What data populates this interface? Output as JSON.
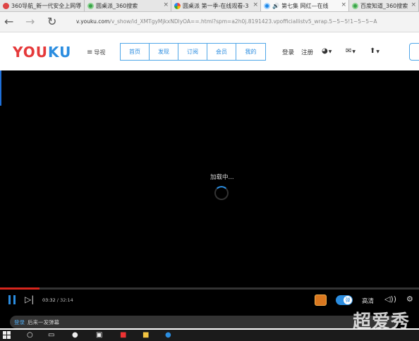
{
  "browser": {
    "tabs": [
      {
        "label": "360导航_新一代安全上网导",
        "favicon": "red-360-icon"
      },
      {
        "label": "圆桌派_360搜索",
        "favicon": "green-360-search-icon"
      },
      {
        "label": "圆桌派 第一季-在线观看-3",
        "favicon": "colorful-site-icon"
      },
      {
        "label": "第七集 网红—在线",
        "favicon": "youku-icon",
        "active": true,
        "audio": "🔊"
      },
      {
        "label": "百度知道_360搜索",
        "favicon": "green-360-search-icon"
      }
    ],
    "back_icon": "←",
    "forward_icon": "→",
    "refresh_icon": "↻",
    "url_host": "v.youku.com",
    "url_path": "/v_show/id_XMTgyMjkxNDlyOA==.html?spm=a2h0j.8191423.vpofficiallistv5_wrap.5~5~5!1~5~5~A"
  },
  "youku": {
    "logo_a": "YOU",
    "logo_b": "KU",
    "menu_label": "导视",
    "nav": [
      "首页",
      "发现",
      "订阅",
      "会员",
      "我的"
    ],
    "login": "登录",
    "register": "注册",
    "icons": [
      "clock-icon",
      "mail-icon",
      "upload-icon"
    ]
  },
  "player": {
    "loading_text": "加载中...",
    "current_time": "03:32",
    "time_sep": " / ",
    "total_time": "32:14",
    "progress": 0.095,
    "danmu_toggle_glyph": "弹",
    "quality": "高清",
    "danmu_login": "登录",
    "danmu_placeholder": "后来一发弹幕"
  },
  "watermark": "超爱秀",
  "colors": {
    "accent_blue": "#2b8de0",
    "youku_red": "#e5393a",
    "progress_red": "#d7261d"
  }
}
